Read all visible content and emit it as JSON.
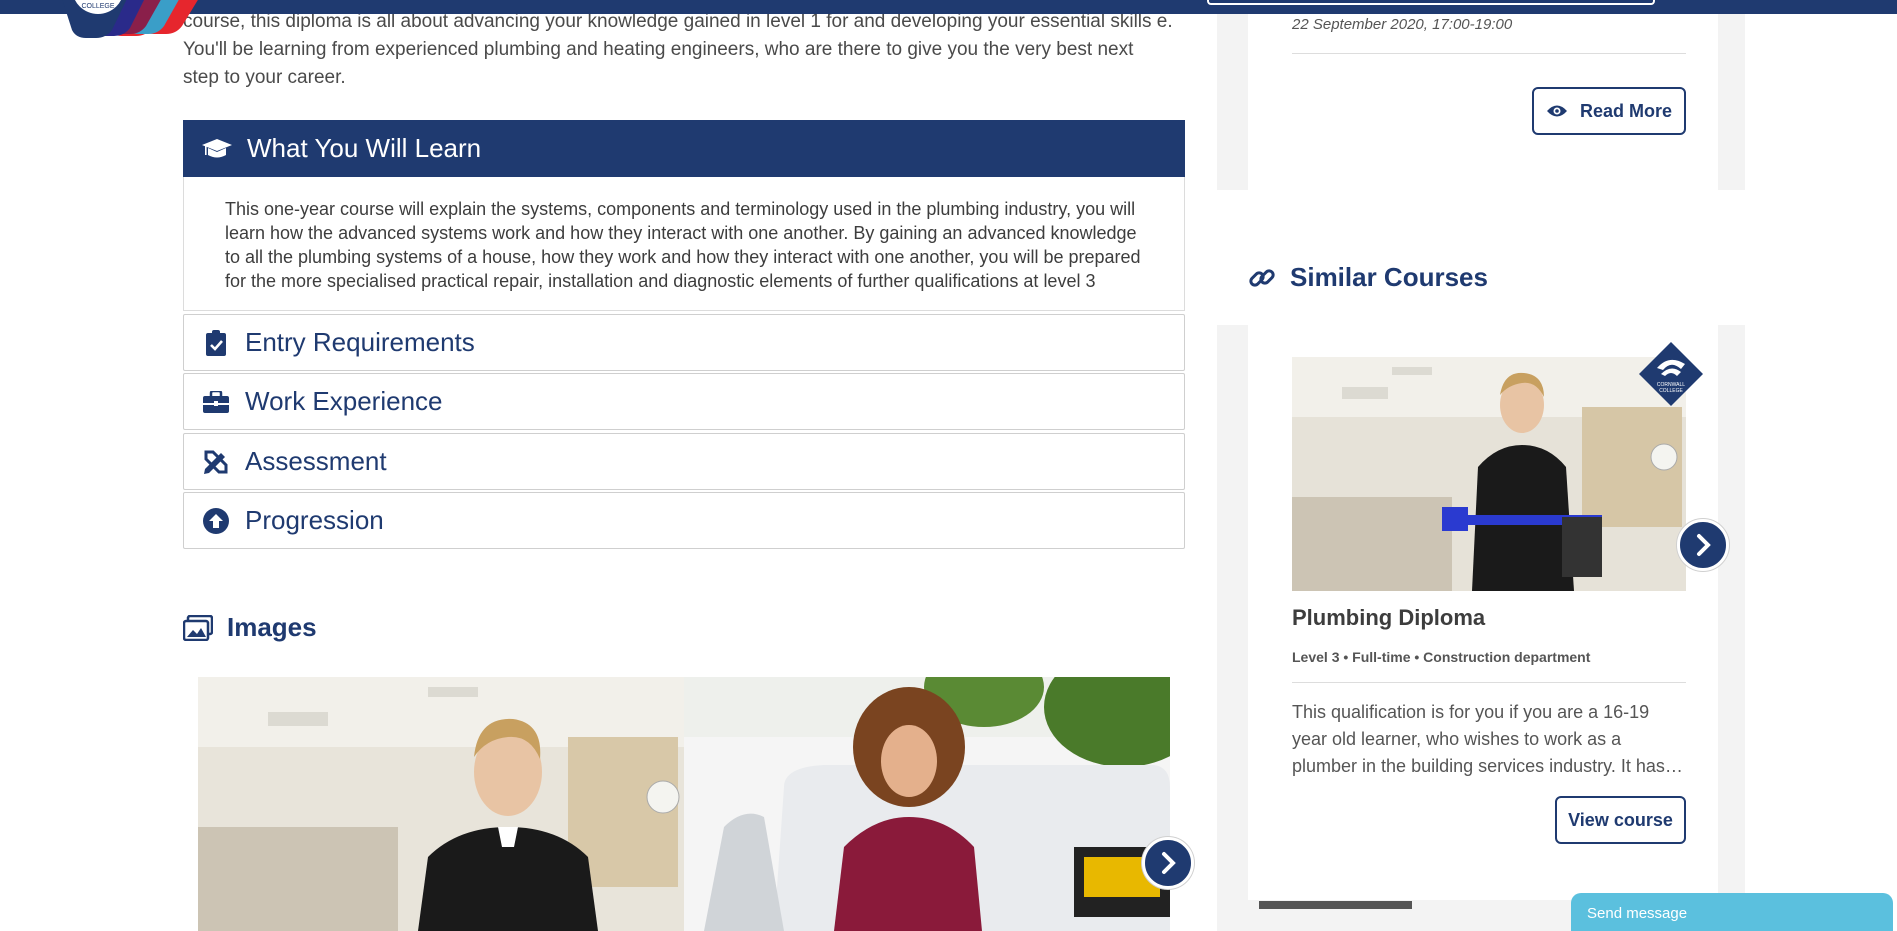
{
  "intro_text": "course, this diploma is all about advancing your knowledge gained in level 1 for and developing your essential skills    e. You'll be learning from experienced plumbing and heating engineers, who are there to give you the very best next step to your career.",
  "accordion": {
    "open_title": "What You Will Learn",
    "open_body": "This one-year course will explain the systems, components and terminology used in the plumbing industry, you will learn how the advanced systems work and how they interact with one another. By gaining an advanced knowledge to all the plumbing systems of a house, how they work and how they interact with one another, you will be prepared for the more specialised practical repair, installation and diagnostic elements of further qualifications at level 3",
    "items": [
      {
        "label": "Entry Requirements",
        "icon": "clipboard-check-icon"
      },
      {
        "label": "Work Experience",
        "icon": "briefcase-icon"
      },
      {
        "label": "Assessment",
        "icon": "pencil-ruler-icon"
      },
      {
        "label": "Progression",
        "icon": "arrow-circle-up-icon"
      }
    ]
  },
  "images_heading": "Images",
  "event": {
    "date": "22 September 2020, 17:00-19:00",
    "read_more": "Read More"
  },
  "similar": {
    "heading": "Similar Courses",
    "course": {
      "title": "Plumbing Diploma",
      "meta": "Level 3 • Full-time • Construction department",
      "description": "This qualification is for you if you are a 16-19 year old learner, who wishes to work as a plumber in the building services industry. It has been designed to…",
      "button": "View course"
    },
    "badge_text": "CORNWALL COLLEGE"
  },
  "logo_text": "CORNWALL COLLEGE",
  "chat": {
    "label": "Send message"
  },
  "colors": {
    "brand": "#1f3a70",
    "chat": "#5bc0de"
  }
}
